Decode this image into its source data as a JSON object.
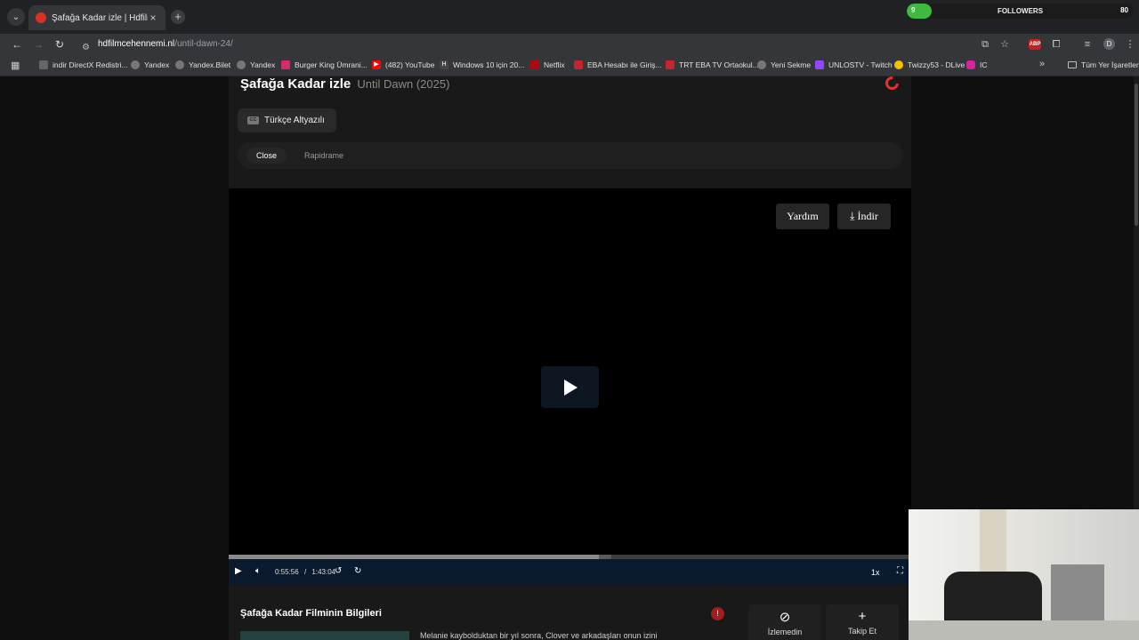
{
  "browser": {
    "tab_title": "Şafağa Kadar izle | Hdfilmcehen",
    "address_domain": "hdfilmcehennemi.nl",
    "address_path": "/until-dawn-24/",
    "bookmarks": [
      "indir DirectX Redistri...",
      "Yandex",
      "Yandex.Bilet",
      "Yandex",
      "Burger King Ümrani...",
      "(482) YouTube",
      "Windows 10 için 20...",
      "Netflix",
      "EBA Hesabı ile Giriş...",
      "TRT EBA TV Ortaokul...",
      "Yeni Sekme",
      "UNLOSTV - Twitch",
      "Twizzy53 - DLive",
      "IC"
    ],
    "all_bookmarks": "Tüm Yer İşaretleri",
    "avatar_letter": "D",
    "abp_label": "ABP"
  },
  "overlay": {
    "followers_label": "FOLLOWERS",
    "followers_count": "9",
    "followers_goal": "80",
    "followers_progress": 0.11
  },
  "page": {
    "title": "Şafağa Kadar izle",
    "original_title": "Until Dawn (2025)",
    "subtitle_button": "Türkçe Altyazılı",
    "cc_label": "CC",
    "servers": [
      "Close",
      "Rapidrame"
    ],
    "active_server": "Close",
    "help_button": "Yardım",
    "download_button": "İndir",
    "player": {
      "current_time": "0:55:56",
      "separator": "/",
      "duration": "1:43:04",
      "speed": "1x",
      "played_fraction": 0.543,
      "buffered_fraction": 0.56
    },
    "info_title": "Şafağa Kadar Filminin Bilgileri",
    "info_badge": "!",
    "actions": [
      {
        "label": "İzlemedin",
        "icon": "eye-off-icon"
      },
      {
        "label": "Takip Et",
        "icon": "plus-icon"
      }
    ],
    "description": "Melanie kaybolduktan bir yıl sonra, Clover ve arkadaşları onun izini"
  }
}
